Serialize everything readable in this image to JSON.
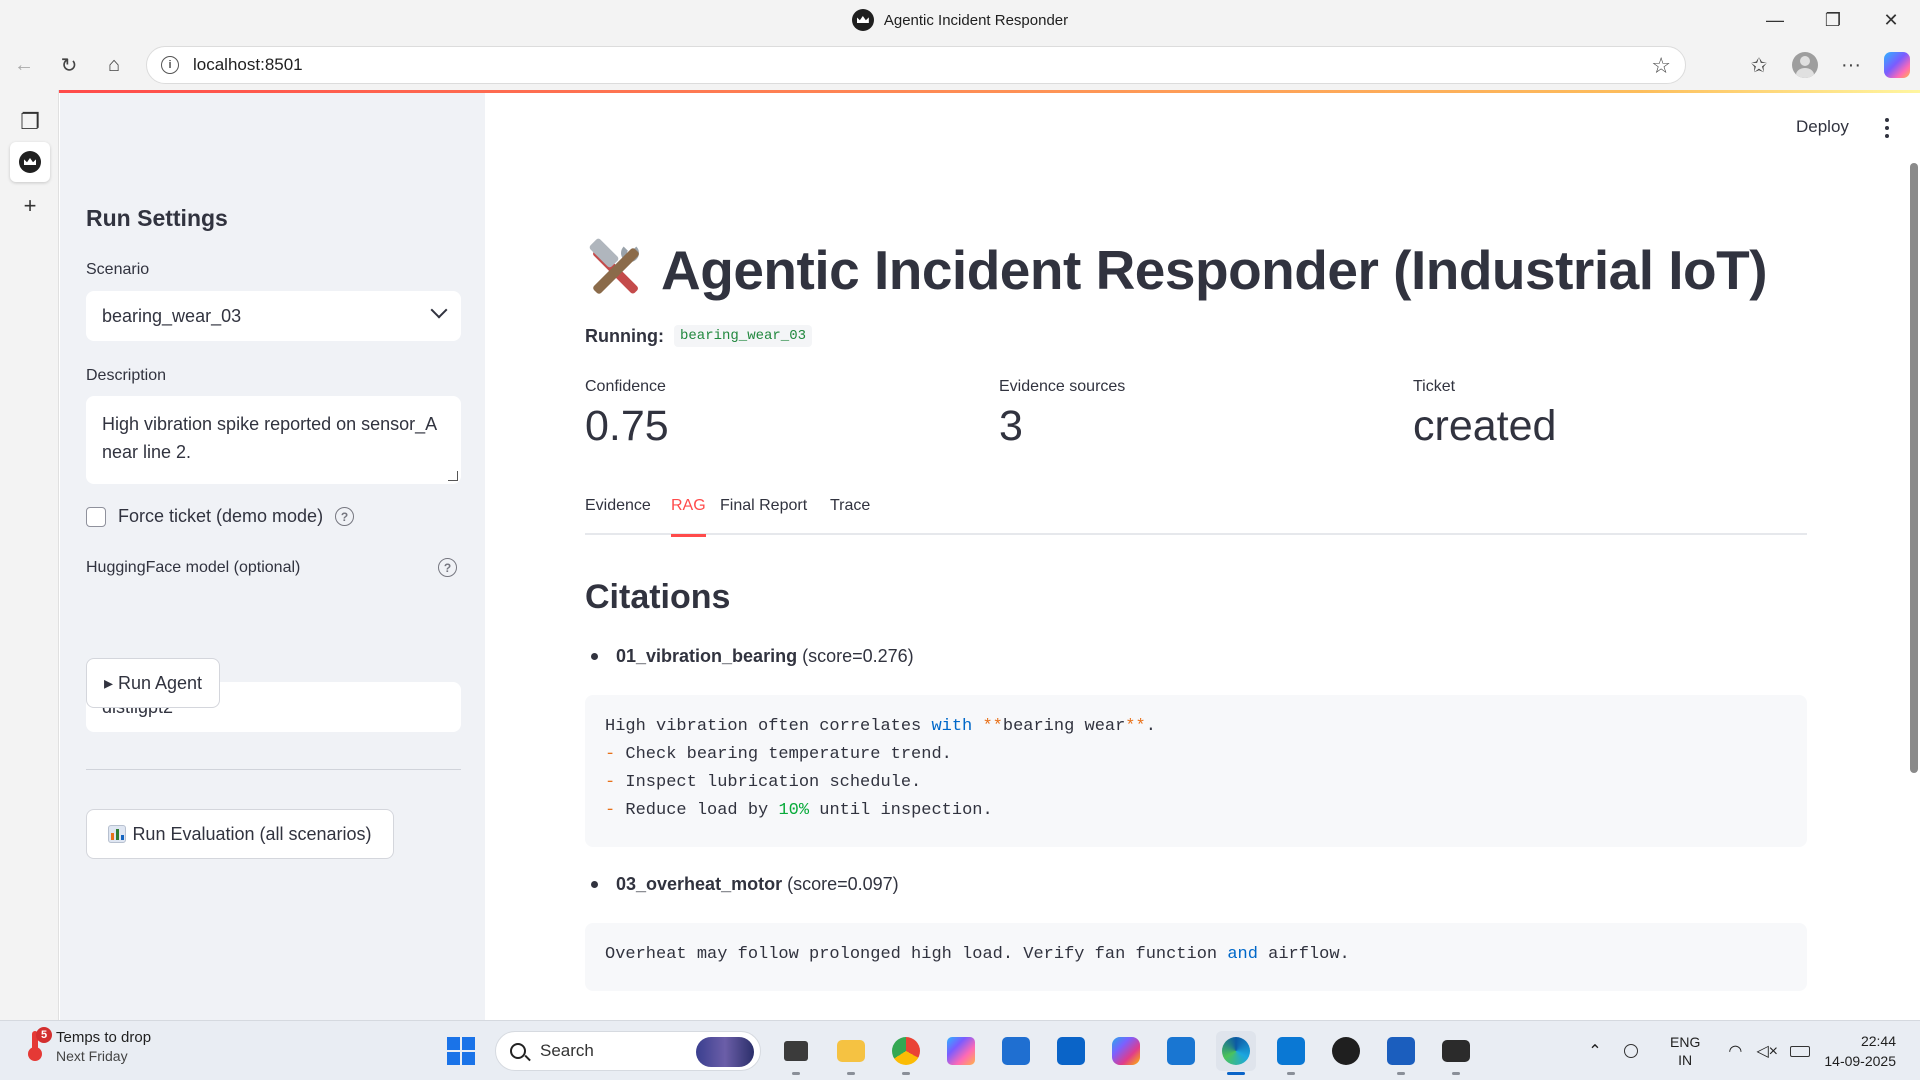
{
  "window": {
    "title": "Agentic Incident Responder",
    "minimize": "—",
    "restore": "❐",
    "close": "✕"
  },
  "browser": {
    "url": "localhost:8501",
    "back_icon": "←",
    "reload_icon": "↻",
    "home_icon": "⌂",
    "star_icon": "☆",
    "favorites_icon": "✩",
    "more_icon": "···",
    "tab_actions_icon": "❐",
    "new_tab_icon": "+"
  },
  "sidebar": {
    "title": "Run Settings",
    "scenario_label": "Scenario",
    "scenario_value": "bearing_wear_03",
    "description_label": "Description",
    "description_value": "High vibration spike reported on sensor_A near line 2.",
    "force_ticket_label": "Force ticket (demo mode)",
    "hf_model_label": "HuggingFace model (optional)",
    "hf_model_value": "distilgpt2",
    "run_agent_label": "▸ Run Agent",
    "run_eval_label": "Run Evaluation (all scenarios)",
    "help_glyph": "?"
  },
  "header": {
    "deploy_label": "Deploy"
  },
  "main": {
    "title": "Agentic Incident Responder (Industrial IoT)",
    "running_label": "Running:",
    "running_value": "bearing_wear_03",
    "metrics": [
      {
        "label": "Confidence",
        "value": "0.75"
      },
      {
        "label": "Evidence sources",
        "value": "3"
      },
      {
        "label": "Ticket",
        "value": "created"
      }
    ],
    "tabs": [
      "Evidence",
      "RAG",
      "Final Report",
      "Trace"
    ],
    "active_tab": "RAG",
    "citations_title": "Citations",
    "citations": [
      {
        "name": "01_vibration_bearing",
        "score": "(score=0.276)"
      },
      {
        "name": "03_overheat_motor",
        "score": "(score=0.097)"
      }
    ],
    "code1": {
      "l1a": "High vibration often correlates ",
      "l1kw": "with",
      "l1b": " ",
      "l1m1": "**",
      "l1c": "bearing wear",
      "l1m2": "**",
      "l1d": ".",
      "dash": "-",
      "l2": " Check bearing temperature trend.",
      "l3": " Inspect lubrication schedule.",
      "l4a": " Reduce load by ",
      "l4num": "10%",
      "l4b": " until inspection."
    },
    "code2": {
      "a": "Overheat may follow prolonged high load. Verify fan function ",
      "kw": "and",
      "b": " airflow."
    }
  },
  "taskbar": {
    "weather_badge": "5",
    "weather_title": "Temps to drop",
    "weather_sub": "Next Friday",
    "search_placeholder": "Search",
    "lang1": "ENG",
    "lang2": "IN",
    "time": "22:44",
    "date": "14-09-2025"
  },
  "colors": {
    "accent": "#ff4b4b",
    "sidebar_bg": "#f0f2f6",
    "code_green": "#21883e"
  }
}
